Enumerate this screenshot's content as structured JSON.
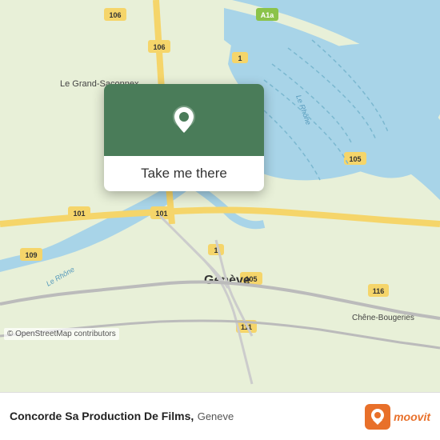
{
  "map": {
    "attribution": "© OpenStreetMap contributors"
  },
  "popup": {
    "button_label": "Take me there"
  },
  "bottom_bar": {
    "venue_name": "Concorde Sa Production De Films,",
    "venue_city": "Geneve"
  },
  "moovit": {
    "label": "moovit"
  }
}
